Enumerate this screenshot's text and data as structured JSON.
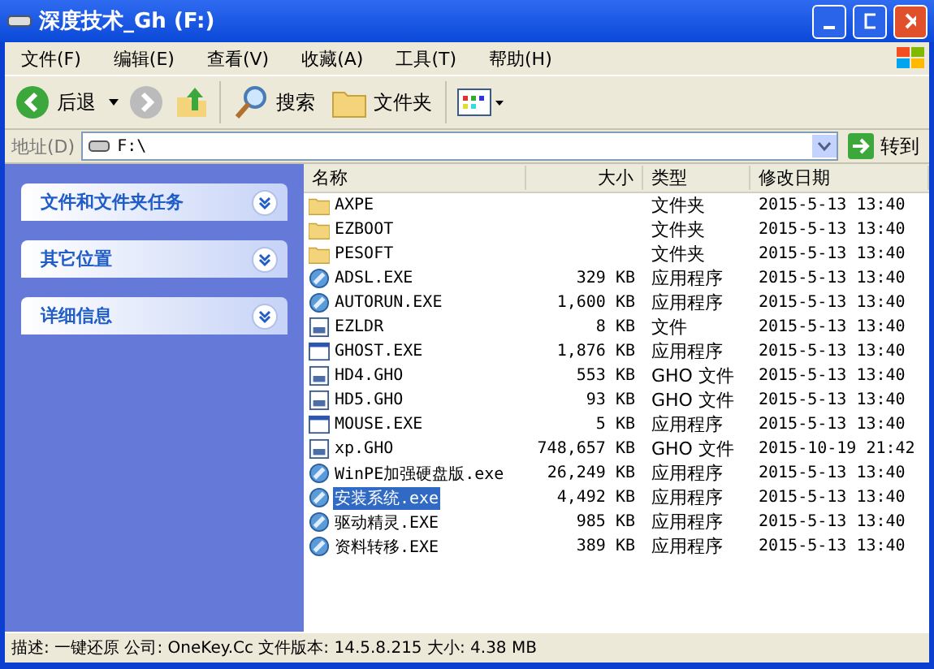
{
  "window": {
    "title": "深度技术_Gh (F:)"
  },
  "menu": [
    "文件(F)",
    "编辑(E)",
    "查看(V)",
    "收藏(A)",
    "工具(T)",
    "帮助(H)"
  ],
  "toolbar": {
    "back": "后退",
    "search": "搜索",
    "folders": "文件夹"
  },
  "address": {
    "label": "地址(D)",
    "value": "F:\\",
    "go": "转到"
  },
  "sidebar": {
    "panels": [
      {
        "title": "文件和文件夹任务",
        "expanded": false
      },
      {
        "title": "其它位置",
        "expanded": false
      },
      {
        "title": "详细信息",
        "expanded": false
      }
    ]
  },
  "table": {
    "columns": [
      "名称",
      "大小",
      "类型",
      "修改日期"
    ],
    "rows": [
      {
        "kind": "folder",
        "name": "AXPE",
        "size": "",
        "type": "文件夹",
        "date": "2015-5-13 13:40",
        "selected": false
      },
      {
        "kind": "folder",
        "name": "EZBOOT",
        "size": "",
        "type": "文件夹",
        "date": "2015-5-13 13:40",
        "selected": false
      },
      {
        "kind": "folder",
        "name": "PESOFT",
        "size": "",
        "type": "文件夹",
        "date": "2015-5-13 13:40",
        "selected": false
      },
      {
        "kind": "app",
        "name": "ADSL.EXE",
        "size": "329 KB",
        "type": "应用程序",
        "date": "2015-5-13 13:40",
        "selected": false
      },
      {
        "kind": "app",
        "name": "AUTORUN.EXE",
        "size": "1,600 KB",
        "type": "应用程序",
        "date": "2015-5-13 13:40",
        "selected": false
      },
      {
        "kind": "file",
        "name": "EZLDR",
        "size": "8 KB",
        "type": "文件",
        "date": "2015-5-13 13:40",
        "selected": false
      },
      {
        "kind": "window",
        "name": "GHOST.EXE",
        "size": "1,876 KB",
        "type": "应用程序",
        "date": "2015-5-13 13:40",
        "selected": false
      },
      {
        "kind": "file",
        "name": "HD4.GHO",
        "size": "553 KB",
        "type": "GHO 文件",
        "date": "2015-5-13 13:40",
        "selected": false
      },
      {
        "kind": "file",
        "name": "HD5.GHO",
        "size": "93 KB",
        "type": "GHO 文件",
        "date": "2015-5-13 13:40",
        "selected": false
      },
      {
        "kind": "window",
        "name": "MOUSE.EXE",
        "size": "5 KB",
        "type": "应用程序",
        "date": "2015-5-13 13:40",
        "selected": false
      },
      {
        "kind": "file",
        "name": "xp.GHO",
        "size": "748,657 KB",
        "type": "GHO 文件",
        "date": "2015-10-19 21:42",
        "selected": false
      },
      {
        "kind": "app",
        "name": "WinPE加强硬盘版.exe",
        "size": "26,249 KB",
        "type": "应用程序",
        "date": "2015-5-13 13:40",
        "selected": false
      },
      {
        "kind": "app",
        "name": "安装系统.exe",
        "size": "4,492 KB",
        "type": "应用程序",
        "date": "2015-5-13 13:40",
        "selected": true
      },
      {
        "kind": "app",
        "name": "驱动精灵.EXE",
        "size": "985 KB",
        "type": "应用程序",
        "date": "2015-5-13 13:40",
        "selected": false
      },
      {
        "kind": "app",
        "name": "资料转移.EXE",
        "size": "389 KB",
        "type": "应用程序",
        "date": "2015-5-13 13:40",
        "selected": false
      }
    ]
  },
  "status_bar": "描述: 一键还原 公司: OneKey.Cc 文件版本: 14.5.8.215 大小: 4.38 MB"
}
